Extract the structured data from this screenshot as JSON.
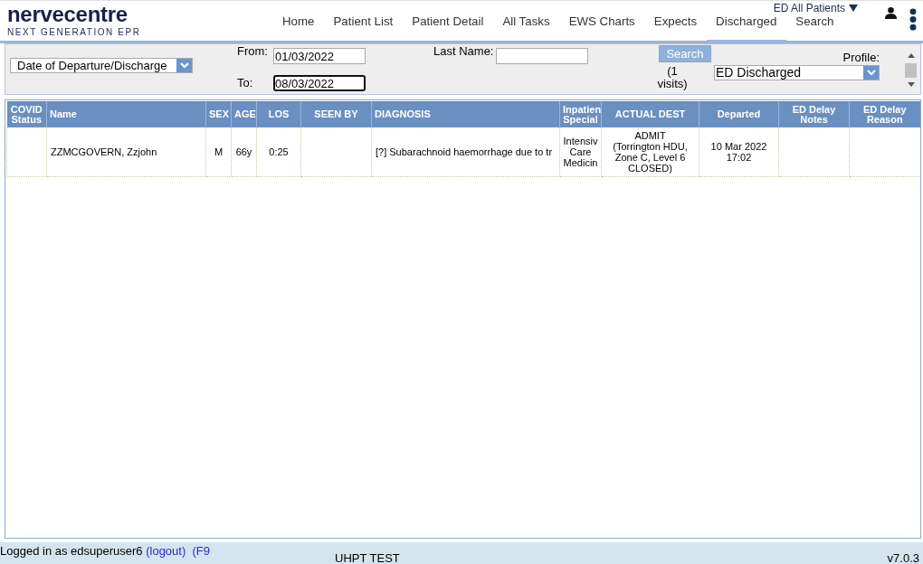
{
  "header": {
    "logo": {
      "name": "nervecentre",
      "tagline": "NEXT GENERATION EPR"
    },
    "nav": [
      {
        "label": "Home",
        "selected": false
      },
      {
        "label": "Patient List",
        "selected": false
      },
      {
        "label": "Patient Detail",
        "selected": false
      },
      {
        "label": "All Tasks",
        "selected": false
      },
      {
        "label": "EWS Charts",
        "selected": false
      },
      {
        "label": "Expects",
        "selected": false
      },
      {
        "label": "Discharged",
        "selected": true
      },
      {
        "label": "Search",
        "selected": false
      }
    ],
    "ward_menu": {
      "label": "ED All Patients"
    }
  },
  "filter": {
    "date_type": {
      "value": "Date of Departure/Discharge"
    },
    "from": {
      "label": "From:",
      "value": "01/03/2022",
      "focused": false
    },
    "to": {
      "label": "To:",
      "value": "08/03/2022",
      "focused": true
    },
    "last_name": {
      "label": "Last Name:",
      "focused": false
    },
    "search_button": "Search",
    "result_count": "(1 visits)",
    "profile": {
      "label": "Profile:",
      "value": "ED Discharged"
    }
  },
  "table": {
    "columns": [
      "COVID Status",
      "Name",
      "SEX",
      "AGE",
      "LOS",
      "SEEN BY",
      "DIAGNOSIS",
      "Inpatien Special",
      "ACTUAL DEST",
      "Departed",
      "ED Delay Notes",
      "ED Delay Reason"
    ],
    "rows": [
      {
        "name": "ZZMCGOVERN, Zzjohn",
        "sex": "M",
        "age": "66y",
        "los": "0:25",
        "diagnosis": "[?] Subarachnoid haemorrhage due to tr",
        "column_8": "Intensiv Care Medicin",
        "actual_dest": "ADMIT\n(Torrington HDU, Zone C, Level 6 CLOSED)",
        "departed": "10 Mar 2022 17:02"
      }
    ]
  },
  "status_bar": {
    "user_text": "Logged in as edsuperuser6",
    "logout_link": "(logout)",
    "back_link": "(F9",
    "environment": "UHPT TEST",
    "version": "v7.0.3"
  }
}
